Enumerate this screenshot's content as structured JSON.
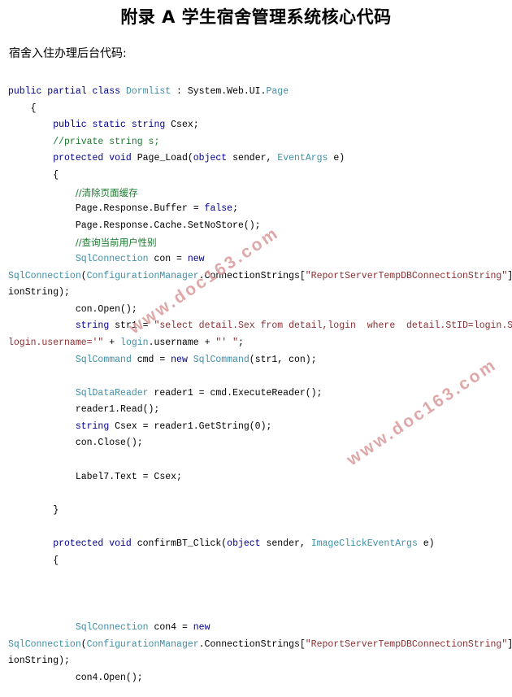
{
  "document": {
    "title": "附录 A  学生宿舍管理系统核心代码",
    "sub_heading": "宿舍入住办理后台代码:"
  },
  "watermark": {
    "text": "www.doc163.com",
    "color": "#d99a9a",
    "count": 2
  },
  "palette": {
    "keyword": "#00008b",
    "type": "#3f8fa6",
    "string": "#8b2f32",
    "comment": "#1a7a2e",
    "plain": "#000000",
    "background": "#ffffff"
  },
  "code": {
    "language": "csharp",
    "lines": [
      {
        "id": 1,
        "indent": 0,
        "tokens": [
          {
            "t": "kw",
            "v": "public partial class "
          },
          {
            "t": "typ",
            "v": "Dormlist"
          },
          {
            "t": "pln",
            "v": " : System.Web.UI."
          },
          {
            "t": "typ",
            "v": "Page"
          }
        ]
      },
      {
        "id": 2,
        "indent": 0,
        "tokens": [
          {
            "t": "pln",
            "v": "    {"
          }
        ]
      },
      {
        "id": 3,
        "indent": 0,
        "tokens": [
          {
            "t": "pln",
            "v": "        "
          },
          {
            "t": "kw",
            "v": "public static string "
          },
          {
            "t": "pln",
            "v": "Csex;"
          }
        ]
      },
      {
        "id": 4,
        "indent": 0,
        "tokens": [
          {
            "t": "pln",
            "v": "        "
          },
          {
            "t": "cmt",
            "v": "//private string s;"
          }
        ]
      },
      {
        "id": 5,
        "indent": 0,
        "tokens": [
          {
            "t": "pln",
            "v": "        "
          },
          {
            "t": "kw",
            "v": "protected void "
          },
          {
            "t": "pln",
            "v": "Page_Load("
          },
          {
            "t": "kw",
            "v": "object"
          },
          {
            "t": "pln",
            "v": " sender, "
          },
          {
            "t": "typ",
            "v": "EventArgs"
          },
          {
            "t": "pln",
            "v": " e)"
          }
        ]
      },
      {
        "id": 6,
        "indent": 0,
        "tokens": [
          {
            "t": "pln",
            "v": "        {"
          }
        ]
      },
      {
        "id": 7,
        "indent": 0,
        "tokens": [
          {
            "t": "pln",
            "v": "            "
          },
          {
            "t": "cmt",
            "v": "//清除页面缓存"
          }
        ]
      },
      {
        "id": 8,
        "indent": 0,
        "tokens": [
          {
            "t": "pln",
            "v": "            Page.Response.Buffer = "
          },
          {
            "t": "kw",
            "v": "false"
          },
          {
            "t": "pln",
            "v": ";"
          }
        ]
      },
      {
        "id": 9,
        "indent": 0,
        "tokens": [
          {
            "t": "pln",
            "v": "            Page.Response.Cache.SetNoStore();"
          }
        ]
      },
      {
        "id": 10,
        "indent": 0,
        "tokens": [
          {
            "t": "pln",
            "v": "            "
          },
          {
            "t": "cmt",
            "v": "//查询当前用户性别"
          }
        ]
      },
      {
        "id": 11,
        "indent": 0,
        "tokens": [
          {
            "t": "pln",
            "v": "            "
          },
          {
            "t": "typ",
            "v": "SqlConnection"
          },
          {
            "t": "pln",
            "v": " con = "
          },
          {
            "t": "kw",
            "v": "new"
          }
        ]
      },
      {
        "id": 12,
        "indent": 0,
        "tokens": [
          {
            "t": "typ",
            "v": "SqlConnection"
          },
          {
            "t": "pln",
            "v": "("
          },
          {
            "t": "typ",
            "v": "ConfigurationManager"
          },
          {
            "t": "pln",
            "v": ".ConnectionStrings["
          },
          {
            "t": "str",
            "v": "\"ReportServerTempDBConnectionString\""
          },
          {
            "t": "pln",
            "v": "].Connec"
          }
        ]
      },
      {
        "id": 13,
        "indent": 0,
        "tokens": [
          {
            "t": "pln",
            "v": "ionString);"
          }
        ]
      },
      {
        "id": 14,
        "indent": 0,
        "tokens": [
          {
            "t": "pln",
            "v": "            con.Open();"
          }
        ]
      },
      {
        "id": 15,
        "indent": 0,
        "tokens": [
          {
            "t": "pln",
            "v": "            "
          },
          {
            "t": "kw",
            "v": "string"
          },
          {
            "t": "pln",
            "v": " str1 = "
          },
          {
            "t": "str",
            "v": "\"select detail.Sex from detail,login  where  detail.StID=login.StID and"
          }
        ]
      },
      {
        "id": 16,
        "indent": 0,
        "tokens": [
          {
            "t": "str",
            "v": "login.username='\""
          },
          {
            "t": "pln",
            "v": " + "
          },
          {
            "t": "typ",
            "v": "login"
          },
          {
            "t": "pln",
            "v": ".username + "
          },
          {
            "t": "str",
            "v": "\"' \""
          },
          {
            "t": "pln",
            "v": ";"
          }
        ]
      },
      {
        "id": 17,
        "indent": 0,
        "tokens": [
          {
            "t": "pln",
            "v": "            "
          },
          {
            "t": "typ",
            "v": "SqlCommand"
          },
          {
            "t": "pln",
            "v": " cmd = "
          },
          {
            "t": "kw",
            "v": "new"
          },
          {
            "t": "pln",
            "v": " "
          },
          {
            "t": "typ",
            "v": "SqlCommand"
          },
          {
            "t": "pln",
            "v": "(str1, con);"
          }
        ]
      },
      {
        "id": 18,
        "indent": 0,
        "tokens": []
      },
      {
        "id": 19,
        "indent": 0,
        "tokens": [
          {
            "t": "pln",
            "v": "            "
          },
          {
            "t": "typ",
            "v": "SqlDataReader"
          },
          {
            "t": "pln",
            "v": " reader1 = cmd.ExecuteReader();"
          }
        ]
      },
      {
        "id": 20,
        "indent": 0,
        "tokens": [
          {
            "t": "pln",
            "v": "            reader1.Read();"
          }
        ]
      },
      {
        "id": 21,
        "indent": 0,
        "tokens": [
          {
            "t": "pln",
            "v": "            "
          },
          {
            "t": "kw",
            "v": "string"
          },
          {
            "t": "pln",
            "v": " Csex = reader1.GetString(0);"
          }
        ]
      },
      {
        "id": 22,
        "indent": 0,
        "tokens": [
          {
            "t": "pln",
            "v": "            con.Close();"
          }
        ]
      },
      {
        "id": 23,
        "indent": 0,
        "tokens": []
      },
      {
        "id": 24,
        "indent": 0,
        "tokens": [
          {
            "t": "pln",
            "v": "            Label7.Text = Csex;"
          }
        ]
      },
      {
        "id": 25,
        "indent": 0,
        "tokens": []
      },
      {
        "id": 26,
        "indent": 0,
        "tokens": [
          {
            "t": "pln",
            "v": "        }"
          }
        ]
      },
      {
        "id": 27,
        "indent": 0,
        "tokens": []
      },
      {
        "id": 28,
        "indent": 0,
        "tokens": [
          {
            "t": "pln",
            "v": "        "
          },
          {
            "t": "kw",
            "v": "protected void "
          },
          {
            "t": "pln",
            "v": "confirmBT_Click("
          },
          {
            "t": "kw",
            "v": "object"
          },
          {
            "t": "pln",
            "v": " sender, "
          },
          {
            "t": "typ",
            "v": "ImageClickEventArgs"
          },
          {
            "t": "pln",
            "v": " e)"
          }
        ]
      },
      {
        "id": 29,
        "indent": 0,
        "tokens": [
          {
            "t": "pln",
            "v": "        {"
          }
        ]
      },
      {
        "id": 30,
        "indent": 0,
        "tokens": []
      },
      {
        "id": 31,
        "indent": 0,
        "tokens": []
      },
      {
        "id": 32,
        "indent": 0,
        "tokens": []
      },
      {
        "id": 33,
        "indent": 0,
        "tokens": [
          {
            "t": "pln",
            "v": "            "
          },
          {
            "t": "typ",
            "v": "SqlConnection"
          },
          {
            "t": "pln",
            "v": " con4 = "
          },
          {
            "t": "kw",
            "v": "new"
          }
        ]
      },
      {
        "id": 34,
        "indent": 0,
        "tokens": [
          {
            "t": "typ",
            "v": "SqlConnection"
          },
          {
            "t": "pln",
            "v": "("
          },
          {
            "t": "typ",
            "v": "ConfigurationManager"
          },
          {
            "t": "pln",
            "v": ".ConnectionStrings["
          },
          {
            "t": "str",
            "v": "\"ReportServerTempDBConnectionString\""
          },
          {
            "t": "pln",
            "v": "].Connec"
          }
        ]
      },
      {
        "id": 35,
        "indent": 0,
        "tokens": [
          {
            "t": "pln",
            "v": "ionString);"
          }
        ]
      },
      {
        "id": 36,
        "indent": 0,
        "tokens": [
          {
            "t": "pln",
            "v": "            con4.Open();"
          }
        ]
      }
    ]
  }
}
